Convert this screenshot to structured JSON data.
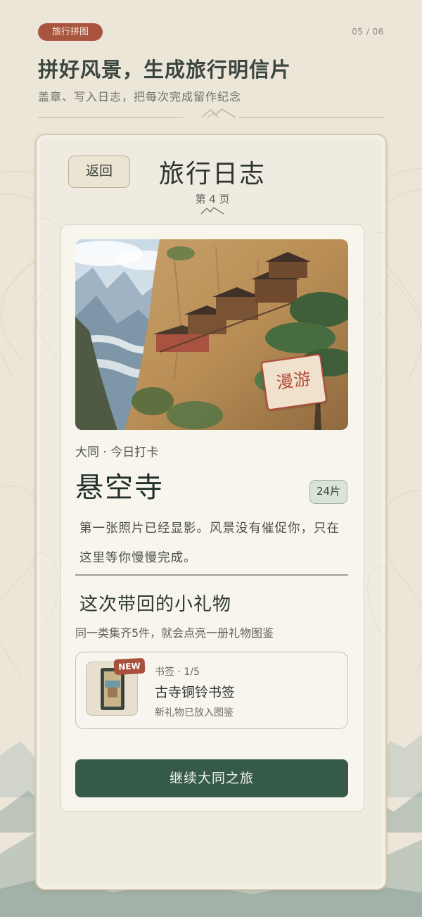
{
  "header": {
    "tag": "旅行拼图",
    "page_indicator": "05 / 06",
    "headline": "拼好风景，生成旅行明信片",
    "subline": "盖章、写入日志，把每次完成留作纪念"
  },
  "journal": {
    "back_label": "返回",
    "title": "旅行日志",
    "page_label": "第 4 页",
    "stamp_text": "漫游",
    "location": "大同 · 今日打卡",
    "place_name": "悬空寺",
    "pieces_badge": "24片",
    "story": "第一张照片已经显影。风景没有催促你，只在这里等你慢慢完成。",
    "gift_heading": "这次带回的小礼物",
    "gift_subtitle": "同一类集齐5件，就会点亮一册礼物图鉴",
    "gift": {
      "new_badge": "NEW",
      "meta": "书签 · 1/5",
      "name": "古寺铜铃书签",
      "note": "新礼物已放入图鉴"
    },
    "continue_label": "继续大同之旅"
  },
  "colors": {
    "accent_red": "#a8543f",
    "primary_green": "#365a4a",
    "paper": "#f8f5ec",
    "background": "#ece6d9"
  }
}
